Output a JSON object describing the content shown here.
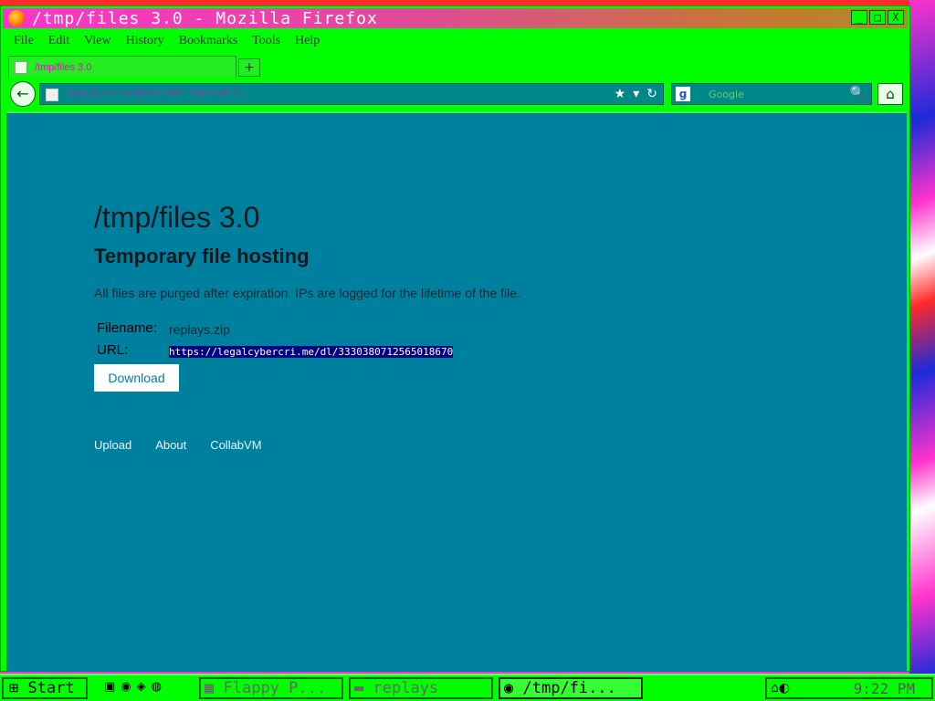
{
  "window": {
    "title": "/tmp/files 3.0 - Mozilla Firefox",
    "controls": {
      "minimize": "_",
      "maximize": "□",
      "close": "X"
    }
  },
  "menubar": {
    "items": [
      "File",
      "Edit",
      "View",
      "History",
      "Bookmarks",
      "Tools",
      "Help"
    ]
  },
  "tabs": {
    "active_label": "/tmp/files 3.0",
    "new_tab": "+"
  },
  "navbar": {
    "back": "←",
    "url": "legalcybercri.me/dl/3330380712565018670",
    "star": "★",
    "dropdown": "▾",
    "reload": "↻",
    "search_engine": "g",
    "search_placeholder": "Google",
    "search_icon": "🔍",
    "home": "⌂"
  },
  "page": {
    "title": "/tmp/files 3.0",
    "subtitle": "Temporary file hosting",
    "notice": "All files are purged after expiration. IPs are logged for the lifetime of the file.",
    "filename_label": "Filename:",
    "filename_value": "replays.zip",
    "url_label": "URL:",
    "url_value": "https://legalcybercri.me/dl/3330380712565018670",
    "download_label": "Download",
    "footer": [
      "Upload",
      "About",
      "CollabVM"
    ]
  },
  "taskbar": {
    "start_label": "Start",
    "tasks": [
      {
        "label": "Flappy P...",
        "active": false
      },
      {
        "label": "replays",
        "active": false
      },
      {
        "label": "/tmp/fi...",
        "active": true
      }
    ],
    "clock": "9:22 PM"
  },
  "colors": {
    "window_green": "#00ff00",
    "content_bg": "#00809f",
    "title_gradient_start": "#ff33cc",
    "selection": "#000080"
  },
  "icons": [
    "firefox-icon",
    "star-icon",
    "reload-icon",
    "search-icon",
    "home-icon",
    "back-arrow-icon"
  ]
}
